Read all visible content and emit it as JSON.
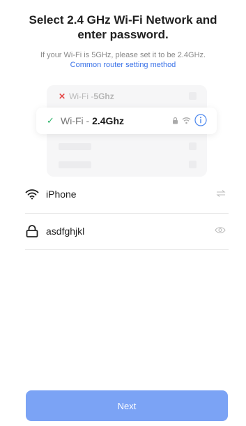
{
  "header": {
    "title": "Select 2.4 GHz Wi-Fi Network and enter password.",
    "hint": "If your Wi-Fi is 5GHz, please set it to be 2.4GHz.",
    "link": "Common router setting method"
  },
  "illustration": {
    "band_5g": {
      "prefix": "Wi-Fi - ",
      "band": "5Ghz",
      "mark": "✕"
    },
    "band_24g": {
      "prefix": "Wi-Fi - ",
      "band": "2.4Ghz",
      "mark": "✓"
    }
  },
  "form": {
    "network_name": "iPhone",
    "password": "asdfghjkl"
  },
  "actions": {
    "next_label": "Next"
  },
  "colors": {
    "accent": "#3a72e8",
    "button": "#7ba3f5",
    "ok": "#2db56b",
    "error": "#e64c4c"
  }
}
